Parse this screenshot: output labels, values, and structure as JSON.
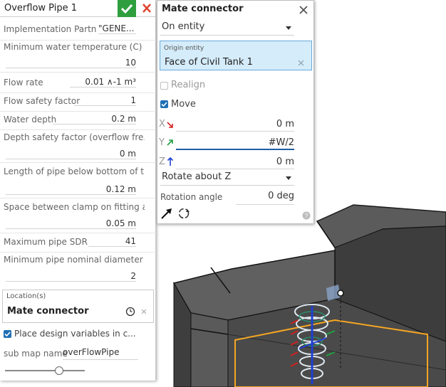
{
  "feature_panel": {
    "title": "Overflow Pipe 1",
    "confirm_icon": "checkmark-icon",
    "cancel_icon": "close-icon",
    "params": [
      {
        "label": "Implementation Partner",
        "value": "\"GENE..."
      },
      {
        "label": "Minimum water temperature (C)",
        "value": "10"
      },
      {
        "label": "Flow rate",
        "value": "0.01 ∧-1 m³"
      },
      {
        "label": "Flow safety factor",
        "value": "1"
      },
      {
        "label": "Water depth",
        "value": "0.2 m"
      },
      {
        "label": "Depth safety factor (overflow fre...",
        "value": "0 m"
      },
      {
        "label": "Length of pipe below bottom of t...",
        "value": "0.12 m"
      },
      {
        "label": "Space between clamp on fitting a...",
        "value": "0.05 m"
      },
      {
        "label": "Maximum pipe SDR",
        "value": "41"
      },
      {
        "label": "Minimum pipe nominal diameter",
        "value": "2"
      }
    ],
    "location": {
      "caption": "Location(s)",
      "value": "Mate connector"
    },
    "place_design_variables": {
      "label": "Place design variables in c...",
      "checked": true
    },
    "sub_map": {
      "label": "sub map name",
      "value": "overFlowPipe"
    },
    "slider_level": 0.68
  },
  "mate_dialog": {
    "title": "Mate connector",
    "close_icon": "close-icon",
    "type_select": "On entity",
    "origin": {
      "caption": "Origin entity",
      "value": "Face of Civil Tank 1"
    },
    "realign": {
      "label": "Realign",
      "checked": false
    },
    "move": {
      "label": "Move",
      "checked": true
    },
    "x": {
      "axis": "X",
      "value": "0 m"
    },
    "y": {
      "axis": "Y",
      "value": "#W/2"
    },
    "z": {
      "axis": "Z",
      "value": "0 m"
    },
    "rotate_select": "Rotate about Z",
    "rotation": {
      "label": "Rotation angle",
      "value": "0 deg"
    }
  },
  "colors": {
    "accent": "#1f6fb5",
    "confirm": "#2e9e3e",
    "cancel": "#e0452f",
    "selection": "#f5a623"
  }
}
